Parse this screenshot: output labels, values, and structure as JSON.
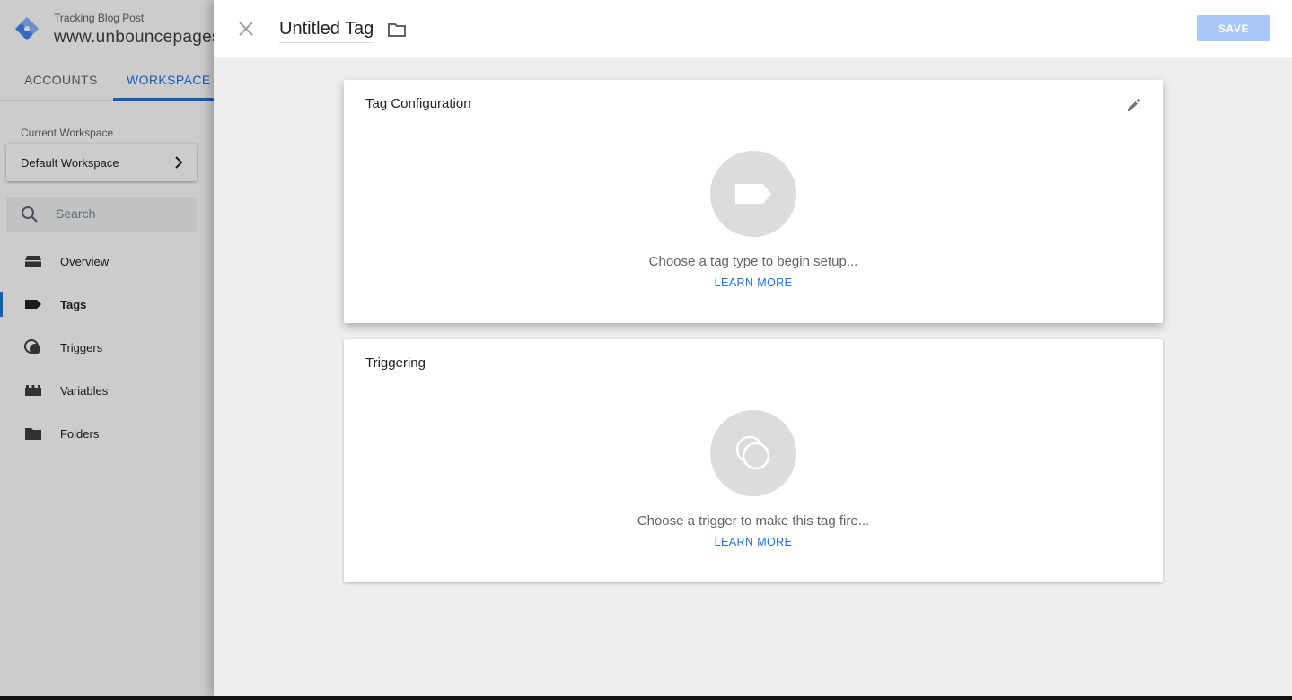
{
  "app": {
    "container_name": "Tracking Blog Post",
    "domain": "www.unbouncepages.com",
    "brand_color": "#1a73e8"
  },
  "tabs": [
    {
      "label": "ACCOUNTS",
      "active": false
    },
    {
      "label": "WORKSPACE",
      "active": true
    }
  ],
  "sidebar": {
    "current_workspace_label": "Current Workspace",
    "current_workspace_value": "Default Workspace",
    "search_placeholder": "Search",
    "items": [
      {
        "label": "Overview",
        "icon": "overview-icon",
        "active": false
      },
      {
        "label": "Tags",
        "icon": "tag-icon",
        "active": true
      },
      {
        "label": "Triggers",
        "icon": "trigger-icon",
        "active": false
      },
      {
        "label": "Variables",
        "icon": "variables-icon",
        "active": false
      },
      {
        "label": "Folders",
        "icon": "folder-icon",
        "active": false
      }
    ]
  },
  "editor": {
    "title": "Untitled Tag",
    "save_label": "SAVE",
    "save_enabled": false,
    "tag_config": {
      "title": "Tag Configuration",
      "hint": "Choose a tag type to begin setup...",
      "learn_more": "LEARN MORE",
      "icon": "tag-icon"
    },
    "triggering": {
      "title": "Triggering",
      "hint": "Choose a trigger to make this tag fire...",
      "learn_more": "LEARN MORE",
      "icon": "trigger-icon"
    }
  }
}
